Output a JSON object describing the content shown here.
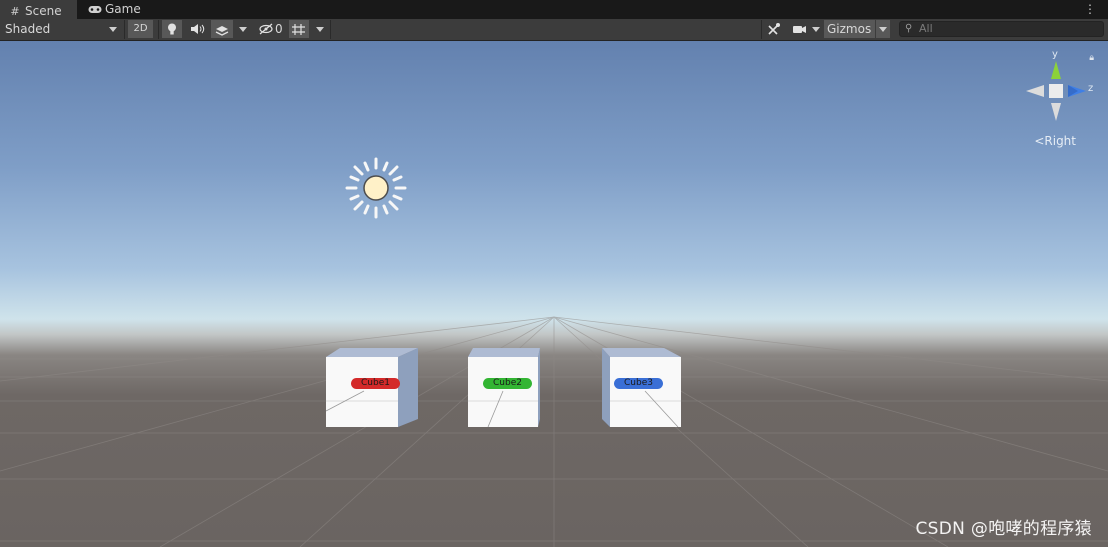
{
  "tabs": [
    {
      "label": "Scene",
      "icon": "hash-grid-icon"
    },
    {
      "label": "Game",
      "icon": "gamepad-icon"
    }
  ],
  "toolbar": {
    "draw_mode": "Shaded",
    "mode_2d": "2D",
    "hidden_count": "0",
    "gizmos": "Gizmos",
    "search_placeholder": "All"
  },
  "cubes": [
    {
      "label": "Cube1",
      "color": "#d42a2a"
    },
    {
      "label": "Cube2",
      "color": "#33b533"
    },
    {
      "label": "Cube3",
      "color": "#3a6fd6"
    }
  ],
  "gizmo": {
    "y_label": "y",
    "z_label": "z",
    "view_label": "Right",
    "y_color": "#8cd23a",
    "z_color": "#3f7fe6"
  },
  "watermark": "CSDN @咆哮的程序猿"
}
